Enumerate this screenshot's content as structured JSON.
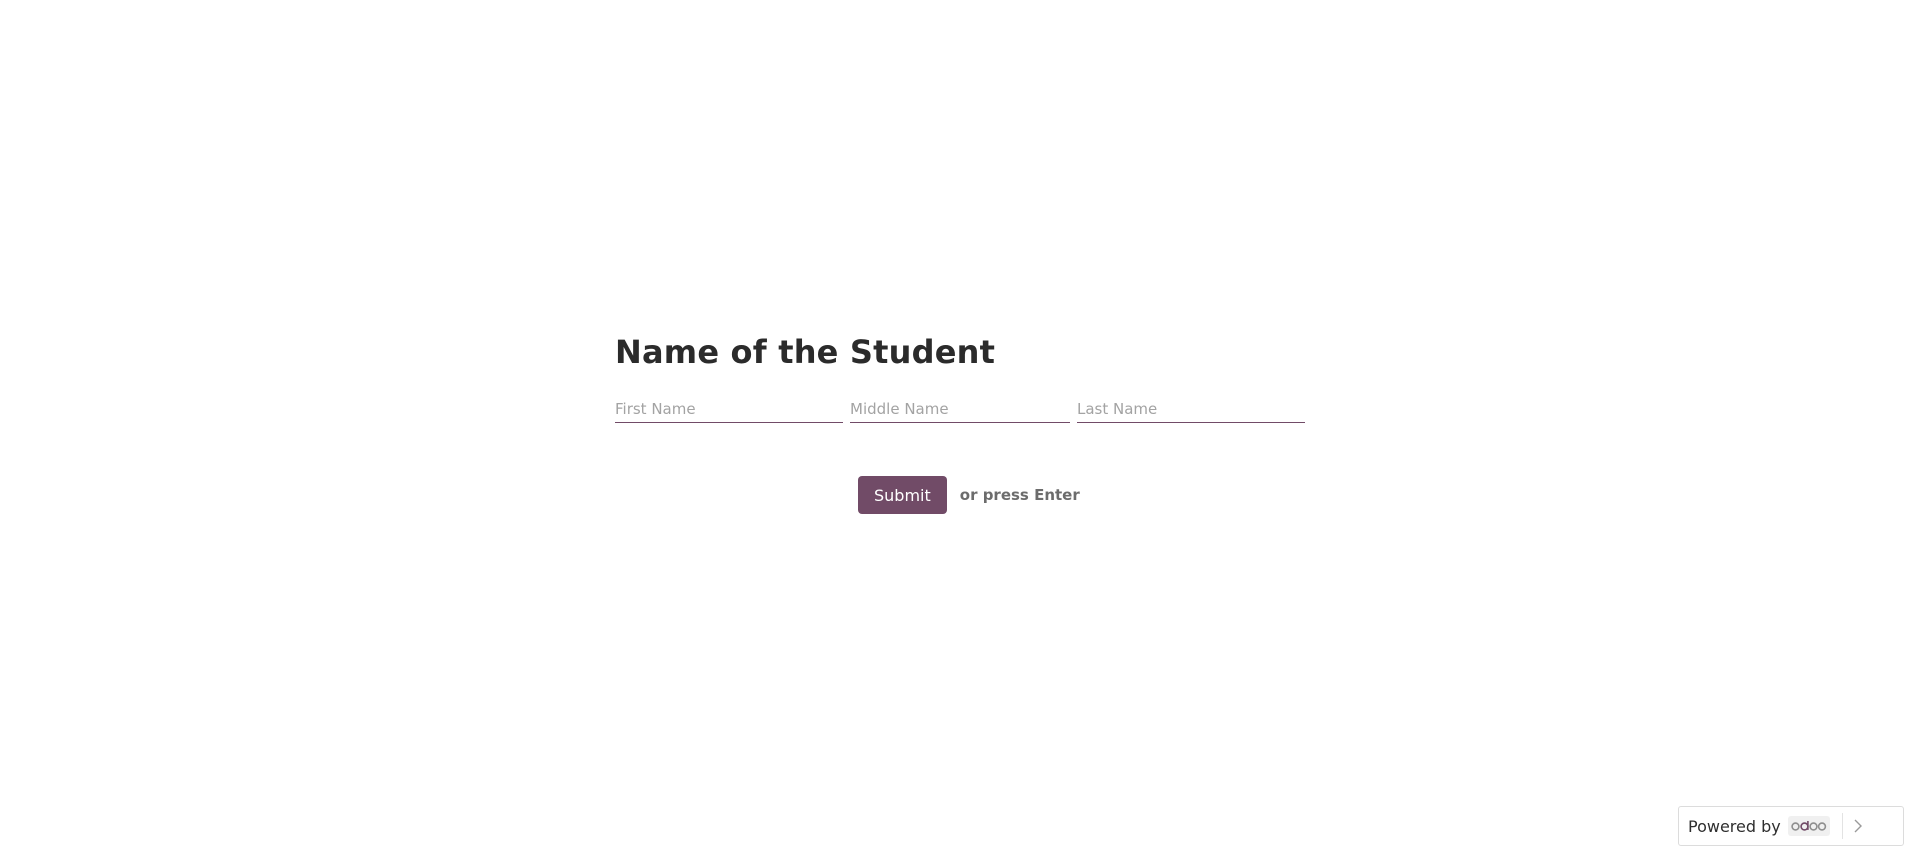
{
  "question": {
    "title": "Name of the Student",
    "fields": [
      {
        "placeholder": "First Name",
        "value": ""
      },
      {
        "placeholder": "Middle Name",
        "value": ""
      },
      {
        "placeholder": "Last Name",
        "value": ""
      }
    ]
  },
  "actions": {
    "submit_label": "Submit",
    "hint": "or press Enter"
  },
  "footer": {
    "powered_label": "Powered by",
    "brand": "odoo",
    "arrow_icon": "chevron-right-icon"
  },
  "colors": {
    "accent": "#714b67",
    "background": "#ffffff"
  }
}
